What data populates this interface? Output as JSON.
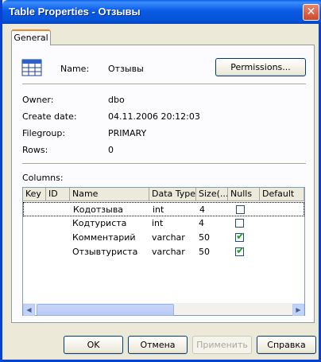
{
  "window": {
    "title": "Table Properties - Отзывы"
  },
  "tabs": [
    {
      "label": "General"
    }
  ],
  "header": {
    "name_label": "Name:",
    "name_value": "Отзывы",
    "permissions_label": "Permissions..."
  },
  "props": {
    "owner_label": "Owner:",
    "owner_value": "dbo",
    "create_label": "Create date:",
    "create_value": "04.11.2006 20:12:03",
    "filegroup_label": "Filegroup:",
    "filegroup_value": "PRIMARY",
    "rows_label": "Rows:",
    "rows_value": "0"
  },
  "columns": {
    "label": "Columns:",
    "headers": [
      "Key",
      "ID",
      "Name",
      "Data Type",
      "Size(...",
      "Nulls",
      "Default"
    ],
    "rows": [
      {
        "name": "Кодотзыва",
        "type": "int",
        "size": "4",
        "nulls": false
      },
      {
        "name": "Кодтуриста",
        "type": "int",
        "size": "4",
        "nulls": false
      },
      {
        "name": "Комментарий",
        "type": "varchar",
        "size": "50",
        "nulls": true
      },
      {
        "name": "Отзывтуриста",
        "type": "varchar",
        "size": "50",
        "nulls": true
      }
    ]
  },
  "footer": {
    "ok": "OK",
    "cancel": "Отмена",
    "apply": "Применить",
    "help": "Справка"
  }
}
